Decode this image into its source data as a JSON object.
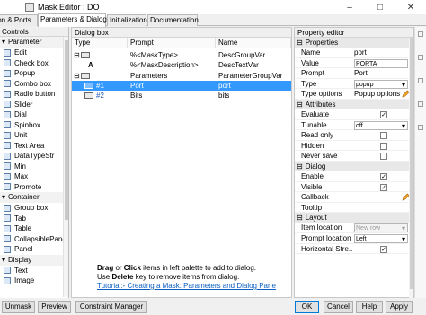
{
  "window": {
    "title": "Mask Editor : DO"
  },
  "tabs": [
    "Icon & Ports",
    "Parameters & Dialog",
    "Initialization",
    "Documentation"
  ],
  "palette": {
    "header": "Controls",
    "sections": [
      {
        "label": "Parameter",
        "items": [
          "Edit",
          "Check box",
          "Popup",
          "Combo box",
          "Radio button",
          "Slider",
          "Dial",
          "Spinbox",
          "Unit",
          "Text Area",
          "DataTypeStr",
          "Min",
          "Max",
          "Promote"
        ]
      },
      {
        "label": "Container",
        "items": [
          "Group box",
          "Tab",
          "Table",
          "CollapsiblePane",
          "Panel"
        ]
      },
      {
        "label": "Display",
        "items": [
          "Text",
          "Image"
        ]
      }
    ]
  },
  "dialog_box": {
    "header": "Dialog box",
    "columns": [
      "Type",
      "Prompt",
      "Name"
    ],
    "rows": [
      {
        "type": "",
        "prompt": "%<MaskType>",
        "name": "DescGroupVar"
      },
      {
        "type": "A",
        "prompt": "%<MaskDescription>",
        "name": "DescTextVar"
      },
      {
        "type": "",
        "prompt": "Parameters",
        "name": "ParameterGroupVar"
      },
      {
        "type": "#1",
        "prompt": "Port",
        "name": "port",
        "selected": true
      },
      {
        "type": "#2",
        "prompt": "Bits",
        "name": "bits"
      }
    ],
    "hint": {
      "drag": "Drag",
      "or": " or ",
      "click": "Click",
      "line1_rest": " items in left palette to add to dialog.",
      "use": "Use ",
      "delete": "Delete",
      "line2_rest": " key to remove items from dialog.",
      "tutorial": "Tutorial:- Creating a Mask: Parameters and Dialog Pane"
    }
  },
  "property_editor": {
    "header": "Property editor",
    "groups": [
      {
        "label": "Properties",
        "rows": [
          {
            "name": "Name",
            "value": "port"
          },
          {
            "name": "Value",
            "value": "PORTA"
          },
          {
            "name": "Prompt",
            "value": "Port"
          },
          {
            "name": "Type",
            "value": "popup"
          },
          {
            "name": "Type options",
            "value": "Popup options"
          }
        ]
      },
      {
        "label": "Attributes",
        "rows": [
          {
            "name": "Evaluate",
            "checked": true
          },
          {
            "name": "Tunable",
            "value": "off"
          },
          {
            "name": "Read only",
            "checked": false
          },
          {
            "name": "Hidden",
            "checked": false
          },
          {
            "name": "Never save",
            "checked": false
          }
        ]
      },
      {
        "label": "Dialog",
        "rows": [
          {
            "name": "Enable",
            "checked": true
          },
          {
            "name": "Visible",
            "checked": true
          },
          {
            "name": "Callback",
            "value": ""
          },
          {
            "name": "Tooltip",
            "value": ""
          }
        ]
      },
      {
        "label": "Layout",
        "rows": [
          {
            "name": "Item location",
            "value": "New row"
          },
          {
            "name": "Prompt location",
            "value": "Left"
          },
          {
            "name": "Horizontal Stre...",
            "checked": true
          }
        ]
      }
    ]
  },
  "footer": {
    "unmask": "Unmask",
    "preview": "Preview",
    "constraint": "Constraint Manager",
    "ok": "OK",
    "cancel": "Cancel",
    "help": "Help",
    "apply": "Apply"
  },
  "colors": {
    "selection": "#3399ff",
    "link": "#0b5ec2"
  }
}
